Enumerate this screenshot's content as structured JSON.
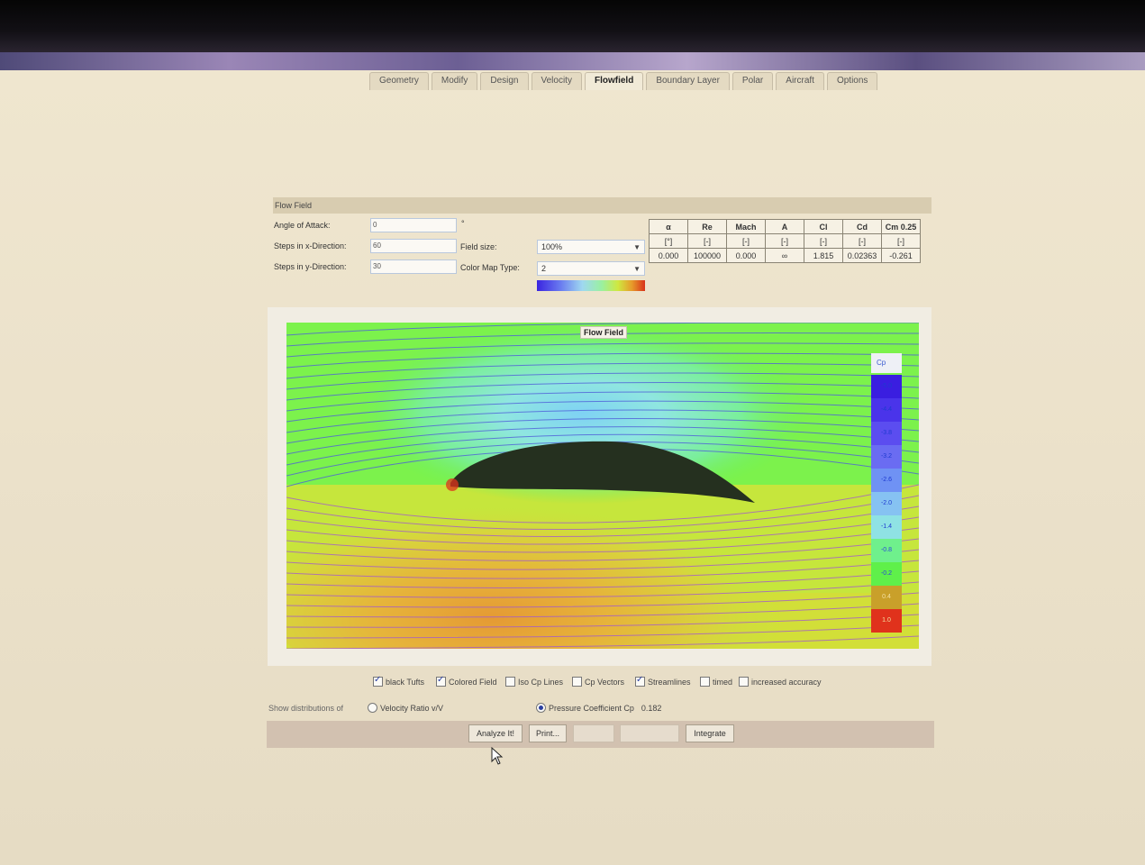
{
  "tabs": [
    "Geometry",
    "Modify",
    "Design",
    "Velocity",
    "Flowfield",
    "Boundary Layer",
    "Polar",
    "Aircraft",
    "Options"
  ],
  "active_tab": "Flowfield",
  "panel_title": "Flow Field",
  "inputs": {
    "angle_of_attack": {
      "label": "Angle of Attack:",
      "value": "0",
      "unit": "°"
    },
    "steps_x": {
      "label": "Steps in x-Direction:",
      "value": "60"
    },
    "steps_y": {
      "label": "Steps in y-Direction:",
      "value": "30"
    },
    "field_size": {
      "label": "Field size:",
      "value": "100%"
    },
    "color_map_type": {
      "label": "Color Map Type:",
      "value": "2"
    }
  },
  "results": {
    "headers": [
      "α",
      "Re",
      "Mach",
      "A",
      "Cl",
      "Cd",
      "Cm 0.25"
    ],
    "units": [
      "[°]",
      "[-]",
      "[-]",
      "[-]",
      "[-]",
      "[-]",
      "[-]"
    ],
    "values": [
      "0.000",
      "100000",
      "0.000",
      "∞",
      "1.815",
      "0.02363",
      "-0.261"
    ]
  },
  "plot": {
    "title": "Flow Field",
    "legend_title": "Cp",
    "legend": [
      {
        "label": "-5.0",
        "color": "#3a1ee0"
      },
      {
        "label": "-4.4",
        "color": "#4a34ea"
      },
      {
        "label": "-3.8",
        "color": "#5b4df0"
      },
      {
        "label": "-3.2",
        "color": "#6a6cf2"
      },
      {
        "label": "-2.6",
        "color": "#6f92f4"
      },
      {
        "label": "-2.0",
        "color": "#86c2f2"
      },
      {
        "label": "-1.4",
        "color": "#8fe2e4"
      },
      {
        "label": "-0.8",
        "color": "#6ff08c"
      },
      {
        "label": "-0.2",
        "color": "#5ff04a"
      },
      {
        "label": "0.4",
        "color": "#c9a02a"
      },
      {
        "label": "1.0",
        "color": "#e0321c"
      }
    ]
  },
  "options": {
    "black_tufts": {
      "label": "black Tufts",
      "checked": true
    },
    "colored_field": {
      "label": "Colored Field",
      "checked": true
    },
    "iso_cp_lines": {
      "label": "Iso Cp Lines",
      "checked": false
    },
    "cp_vectors": {
      "label": "Cp Vectors",
      "checked": false
    },
    "streamlines": {
      "label": "Streamlines",
      "checked": true
    },
    "timed": {
      "label": "timed",
      "checked": false
    },
    "increased_accuracy": {
      "label": "increased accuracy",
      "checked": false
    }
  },
  "distributions": {
    "label": "Show distributions of",
    "velocity_ratio": "Velocity Ratio v/V",
    "pressure_coefficient": "Pressure Coefficient Cp",
    "pressure_value": "0.182",
    "selected": "pressure_coefficient"
  },
  "buttons": {
    "analyze": "Analyze It!",
    "print": "Print...",
    "integrate": "Integrate"
  }
}
